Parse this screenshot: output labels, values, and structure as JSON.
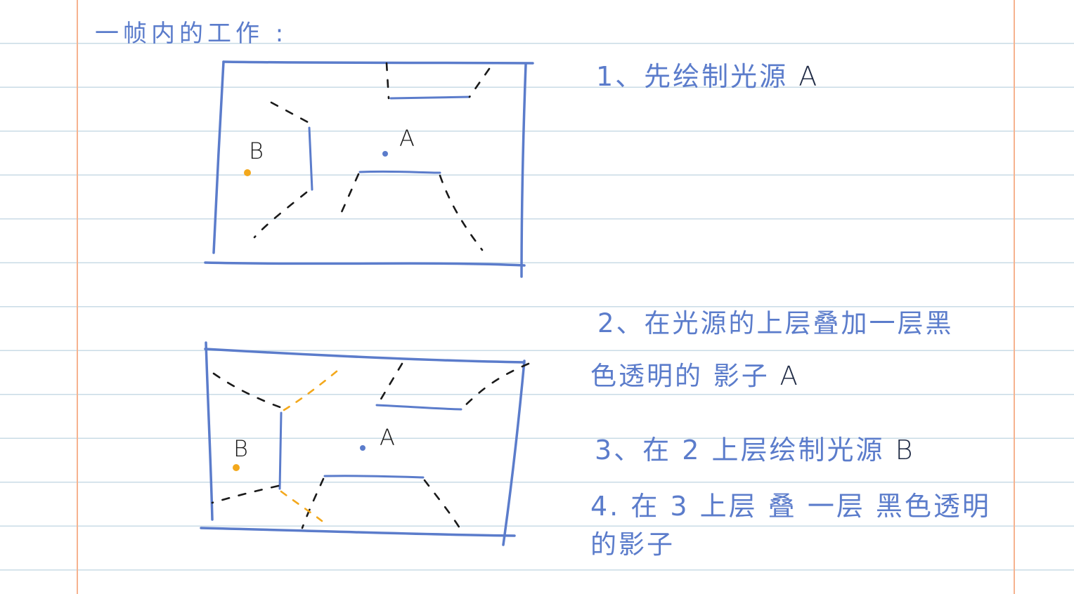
{
  "heading": "一帧内的工作 :",
  "steps": {
    "step1": {
      "text": "1、先绘制光源",
      "letter": "A"
    },
    "step2": {
      "line1": "2、在光源的上层叠加一层黑",
      "line2": "色透明的 影子",
      "letter": "A"
    },
    "step3": {
      "text": "3、在 2 上层绘制光源",
      "letter": "B"
    },
    "step4": {
      "line1": "4. 在 3 上层 叠 一层 黑色透明",
      "line2": "的影子"
    }
  },
  "diagrams": {
    "top": {
      "light_a_label": "A",
      "light_b_label": "B"
    },
    "bottom": {
      "light_a_label": "A",
      "light_b_label": "B"
    }
  },
  "colors": {
    "ink_blue": "#5b7ccb",
    "ink_black": "#1a1a1a",
    "light_a": "#5b7ccb",
    "light_b": "#f3a81c",
    "ruled_line": "#c9dbe6",
    "margin_line": "#f6b38f"
  }
}
